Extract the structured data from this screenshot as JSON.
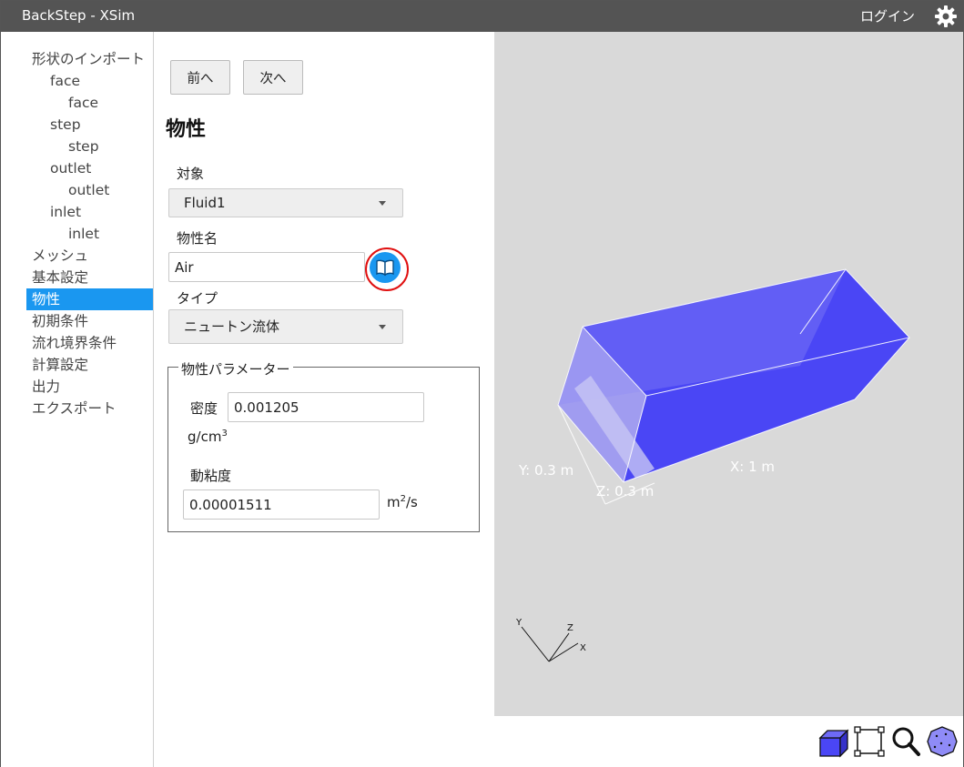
{
  "window": {
    "title": "BackStep - XSim",
    "login": "ログイン"
  },
  "sidebar": {
    "items": [
      {
        "label": "形状のインポート",
        "level": 0
      },
      {
        "label": "face",
        "level": 1
      },
      {
        "label": "face",
        "level": 2
      },
      {
        "label": "step",
        "level": 1
      },
      {
        "label": "step",
        "level": 2
      },
      {
        "label": "outlet",
        "level": 1
      },
      {
        "label": "outlet",
        "level": 2
      },
      {
        "label": "inlet",
        "level": 1
      },
      {
        "label": "inlet",
        "level": 2
      },
      {
        "label": "メッシュ",
        "level": 0
      },
      {
        "label": "基本設定",
        "level": 0
      },
      {
        "label": "物性",
        "level": 0,
        "active": true
      },
      {
        "label": "初期条件",
        "level": 0
      },
      {
        "label": "流れ境界条件",
        "level": 0
      },
      {
        "label": "計算設定",
        "level": 0
      },
      {
        "label": "出力",
        "level": 0
      },
      {
        "label": "エクスポート",
        "level": 0
      }
    ]
  },
  "form": {
    "prev_label": "前へ",
    "next_label": "次へ",
    "title": "物性",
    "target_label": "対象",
    "target_value": "Fluid1",
    "material_name_label": "物性名",
    "material_name_value": "Air",
    "type_label": "タイプ",
    "type_value": "ニュートン流体",
    "params_legend": "物性パラメーター",
    "density_label": "密度",
    "density_value": "0.001205",
    "density_unit_base": "g/cm",
    "density_unit_exp": "3",
    "viscosity_label": "動粘度",
    "viscosity_value": "0.00001511",
    "viscosity_unit_base": "m",
    "viscosity_unit_exp": "2",
    "viscosity_unit_tail": "/s"
  },
  "viewport": {
    "dim_x": "X: 1 m",
    "dim_y": "Y: 0.3 m",
    "dim_z": "Z: 0.3 m",
    "axis_x": "X",
    "axis_y": "Y",
    "axis_z": "Z",
    "model_color": "#4a46f5",
    "background_color": "#d9d9d9"
  },
  "toolbar": {
    "tools": [
      "cube-view-icon",
      "fit-frame-icon",
      "zoom-icon",
      "sphere-view-icon"
    ]
  },
  "colors": {
    "accent": "#1a97f0",
    "titlebar": "#545454",
    "highlight_ring": "#e01010"
  }
}
